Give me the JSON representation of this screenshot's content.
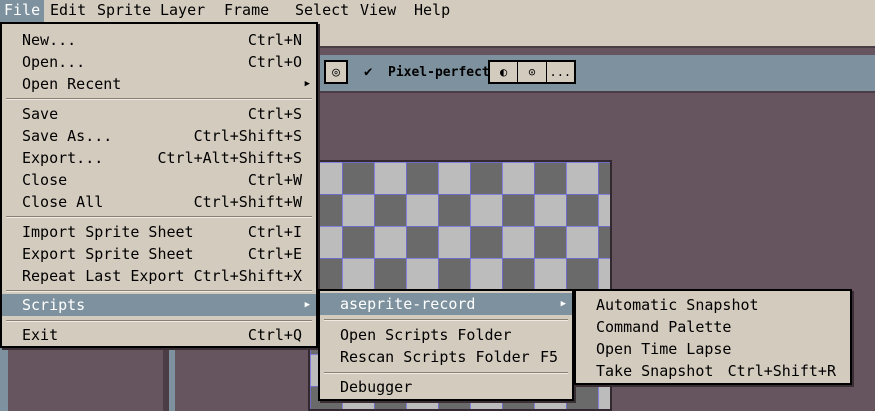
{
  "menubar": {
    "items": [
      {
        "label": "File"
      },
      {
        "label": "Edit"
      },
      {
        "label": "Sprite"
      },
      {
        "label": "Layer"
      },
      {
        "label": "Frame"
      },
      {
        "label": "Select"
      },
      {
        "label": "View"
      },
      {
        "label": "Help"
      }
    ]
  },
  "toolbar": {
    "pixel_perfect_label": "Pixel-perfect",
    "more_label": "..."
  },
  "file_menu": {
    "items": [
      {
        "label": "New...",
        "shortcut": "Ctrl+N"
      },
      {
        "label": "Open...",
        "shortcut": "Ctrl+O"
      },
      {
        "label": "Open Recent",
        "shortcut": ""
      },
      {
        "label": "Save",
        "shortcut": "Ctrl+S"
      },
      {
        "label": "Save As...",
        "shortcut": "Ctrl+Shift+S"
      },
      {
        "label": "Export...",
        "shortcut": "Ctrl+Alt+Shift+S"
      },
      {
        "label": "Close",
        "shortcut": "Ctrl+W"
      },
      {
        "label": "Close All",
        "shortcut": "Ctrl+Shift+W"
      },
      {
        "label": "Import Sprite Sheet",
        "shortcut": "Ctrl+I"
      },
      {
        "label": "Export Sprite Sheet",
        "shortcut": "Ctrl+E"
      },
      {
        "label": "Repeat Last Export",
        "shortcut": "Ctrl+Shift+X"
      },
      {
        "label": "Scripts",
        "shortcut": ""
      },
      {
        "label": "Exit",
        "shortcut": "Ctrl+Q"
      }
    ]
  },
  "scripts_menu": {
    "items": [
      {
        "label": "aseprite-record",
        "shortcut": ""
      },
      {
        "label": "Open Scripts Folder",
        "shortcut": ""
      },
      {
        "label": "Rescan Scripts Folder",
        "shortcut": "F5"
      },
      {
        "label": "Debugger",
        "shortcut": ""
      }
    ]
  },
  "record_menu": {
    "items": [
      {
        "label": "Automatic Snapshot",
        "shortcut": ""
      },
      {
        "label": "Command Palette",
        "shortcut": ""
      },
      {
        "label": "Open Time Lapse",
        "shortcut": ""
      },
      {
        "label": "Take Snapshot",
        "shortcut": "Ctrl+Shift+R"
      }
    ]
  },
  "colors": {
    "menu_bg": "#d3cbbe",
    "highlight": "#7d929e",
    "workspace": "#66555f"
  }
}
